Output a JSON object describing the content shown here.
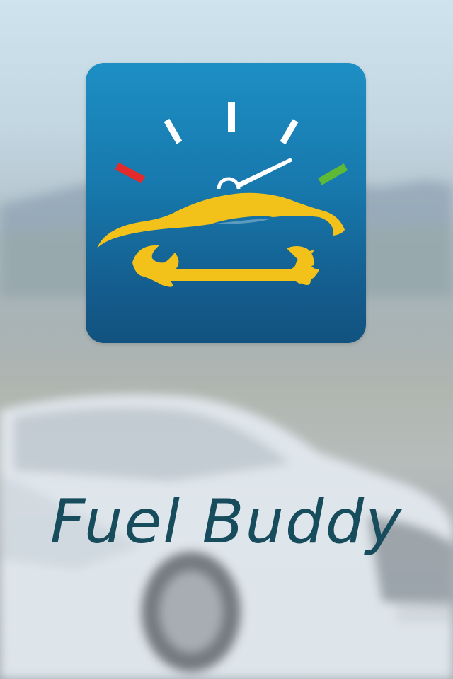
{
  "app": {
    "title": "Fuel Buddy"
  },
  "icon": {
    "name": "fuel-buddy-logo-icon",
    "elements": [
      "gauge-icon",
      "car-icon",
      "wrench-icon"
    ]
  },
  "colors": {
    "icon_bg_top": "#1d8fc4",
    "icon_bg_bottom": "#12527f",
    "gauge_low": "#e32b2b",
    "gauge_high": "#5db936",
    "accent_yellow": "#f2c21b",
    "title_text": "#174c5c"
  }
}
